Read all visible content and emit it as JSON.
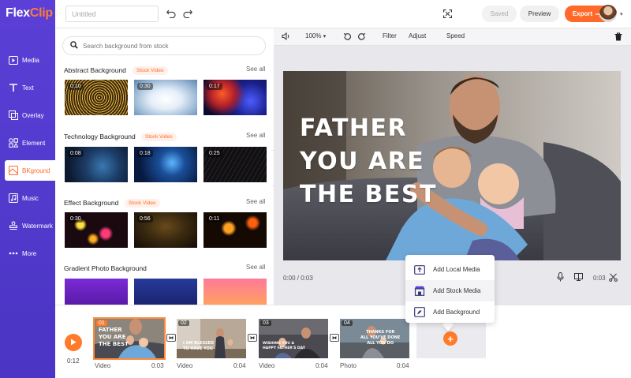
{
  "app": {
    "logo_part1": "Flex",
    "logo_part2": "Clip"
  },
  "sidebar": {
    "items": [
      {
        "label": "Media",
        "icon": "media-icon"
      },
      {
        "label": "Text",
        "icon": "text-icon"
      },
      {
        "label": "Overlay",
        "icon": "overlay-icon"
      },
      {
        "label": "Element",
        "icon": "element-icon"
      },
      {
        "label": "BKground",
        "icon": "background-icon",
        "active": true
      },
      {
        "label": "Music",
        "icon": "music-icon"
      },
      {
        "label": "Watermark",
        "icon": "watermark-icon"
      },
      {
        "label": "More",
        "icon": "more-icon"
      }
    ]
  },
  "topbar": {
    "title_placeholder": "Untitled",
    "saved_label": "Saved",
    "preview_label": "Preview",
    "export_label": "Export",
    "export_icon": "arrow-right-icon",
    "undo_icon": "undo-icon",
    "redo_icon": "redo-icon",
    "fullscreen_icon": "fullscreen-icon"
  },
  "library": {
    "search_placeholder": "Search background from stock",
    "sections": [
      {
        "title": "Abstract Background",
        "badge": "Stock Video",
        "see_all": "See all",
        "thumbs": [
          {
            "dur": "0:10"
          },
          {
            "dur": "0:30"
          },
          {
            "dur": "0:17"
          }
        ]
      },
      {
        "title": "Technology Background",
        "badge": "Stock Video",
        "see_all": "See all",
        "thumbs": [
          {
            "dur": "0:08"
          },
          {
            "dur": "0:18"
          },
          {
            "dur": "0:25"
          }
        ]
      },
      {
        "title": "Effect Background",
        "badge": "Stock Video",
        "see_all": "See all",
        "thumbs": [
          {
            "dur": "0:30"
          },
          {
            "dur": "0:56"
          },
          {
            "dur": "0:11"
          }
        ]
      },
      {
        "title": "Gradient Photo Background",
        "badge": "",
        "see_all": "See all",
        "thumbs": [
          {
            "dur": ""
          },
          {
            "dur": ""
          },
          {
            "dur": ""
          }
        ]
      }
    ]
  },
  "stage": {
    "toolbar": {
      "zoom": "100%",
      "filter": "Filter",
      "adjust": "Adjust",
      "speed": "Speed"
    },
    "overlay_lines": [
      "FATHER",
      "YOU ARE",
      "THE BEST"
    ],
    "current_time": "0:00 / 0:03",
    "end_time": "0:03"
  },
  "add_menu": {
    "items": [
      {
        "label": "Add Local Media",
        "icon": "upload-media-icon"
      },
      {
        "label": "Add Stock Media",
        "icon": "stock-store-icon"
      },
      {
        "label": "Add Background",
        "icon": "background-fill-icon"
      }
    ]
  },
  "timeline": {
    "total_time": "0:12",
    "clips": [
      {
        "num": "01",
        "type": "Video",
        "dur": "0:03",
        "caption": [
          "FATHER",
          "YOU ARE",
          "THE BEST"
        ]
      },
      {
        "num": "02",
        "type": "Video",
        "dur": "0:04",
        "caption": [
          "I AM BLESSED",
          "TO HAVE YOU"
        ]
      },
      {
        "num": "03",
        "type": "Video",
        "dur": "0:04",
        "caption": [
          "WISHING YOU A",
          "HAPPY FATHER'S DAY"
        ]
      },
      {
        "num": "04",
        "type": "Photo",
        "dur": "0:04",
        "caption": [
          "THANKS FOR",
          "ALL YOU'VE DONE",
          "ALL YOU DO"
        ]
      }
    ],
    "add_symbol": "+"
  },
  "colors": {
    "accent": "#ff6a2b",
    "rail": "#5b3fd6"
  }
}
